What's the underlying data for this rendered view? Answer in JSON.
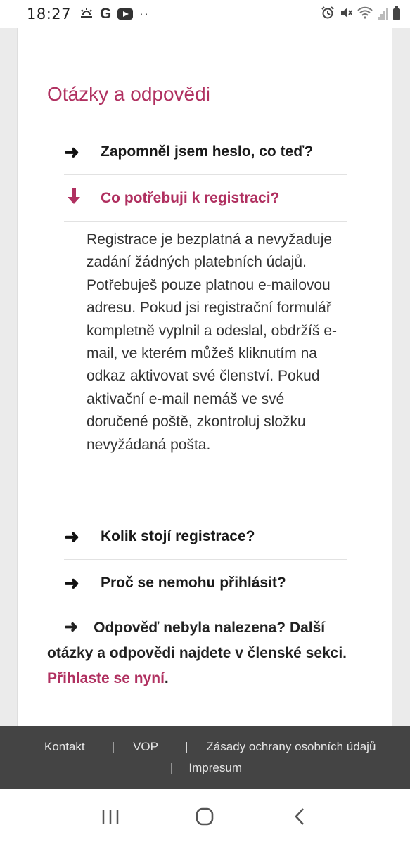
{
  "status_bar": {
    "time": "18:27",
    "left_icons": [
      "weather-sun-icon",
      "google-icon",
      "youtube-icon",
      "more-dots-icon"
    ],
    "right_icons": [
      "alarm-icon",
      "mute-icon",
      "wifi-icon",
      "signal-icon",
      "battery-icon"
    ]
  },
  "faq": {
    "title": "Otázky a odpovědi",
    "items": [
      {
        "question": "Zapomněl jsem heslo, co teď?",
        "open": false
      },
      {
        "question": "Co potřebuji k registraci?",
        "open": true
      },
      {
        "question": "Kolik stojí registrace?",
        "open": false
      },
      {
        "question": "Proč se nemohu přihlásit?",
        "open": false
      }
    ],
    "open_answer": "Registrace je bezplatná a nevyžaduje zadání žádných platebních údajů. Potřebuješ pouze platnou e-mailovou adresu. Pokud jsi registrační formulář kompletně vyplnil a odeslal, obdržíš e-mail, ve kterém můžeš kliknutím na odkaz aktivovat své členství. Pokud aktivační e-mail nemáš ve své doručené poště, zkontroluj složku nevyžádaná pošta.",
    "not_found_text": "Odpověď nebyla nalezena? Další otázky a odpovědi najdete v členské sekci.",
    "login_link": "Přihlaste se nyní",
    "login_suffix": ".",
    "accent_color": "#b03060"
  },
  "footer": {
    "links": [
      "Kontakt",
      "VOP",
      "Zásady ochrany osobních údajů",
      "Impresum"
    ],
    "separator": "|"
  },
  "nav_bar": {
    "buttons": [
      "recent-apps-icon",
      "home-icon",
      "back-icon"
    ]
  }
}
